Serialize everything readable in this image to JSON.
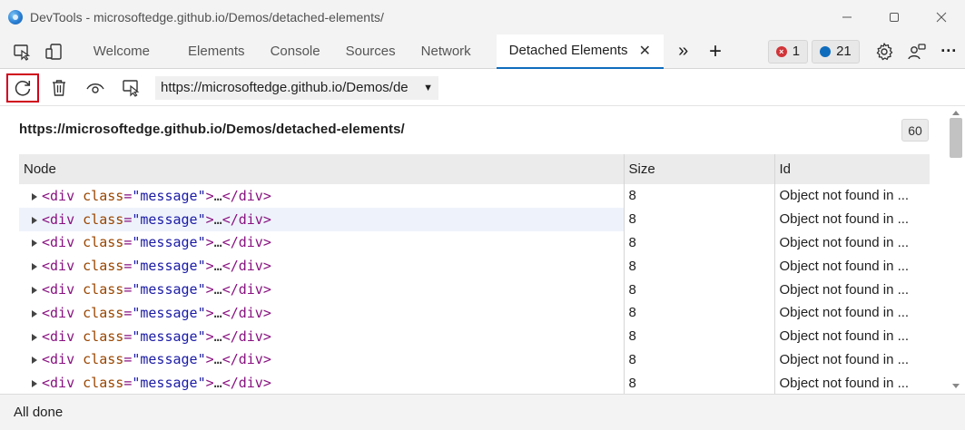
{
  "window": {
    "title": "DevTools - microsoftedge.github.io/Demos/detached-elements/",
    "icon": "edge-devtools-icon"
  },
  "tabs": [
    {
      "label": "Welcome",
      "active": false
    },
    {
      "label": "Elements",
      "active": false
    },
    {
      "label": "Console",
      "active": false
    },
    {
      "label": "Sources",
      "active": false
    },
    {
      "label": "Network",
      "active": false
    },
    {
      "label": "Detached Elements",
      "active": true
    }
  ],
  "tabstrip": {
    "more_tabs": "»",
    "add_tab": "+",
    "error_count": "1",
    "message_count": "21",
    "more_menu": "···"
  },
  "toolbar": {
    "url_select_value": "https://microsoftedge.github.io/Demos/de",
    "caret": "▼"
  },
  "content": {
    "page_url": "https://microsoftedge.github.io/Demos/detached-elements/",
    "count": "60"
  },
  "table": {
    "headers": [
      "Node",
      "Size",
      "Id"
    ],
    "rows": [
      {
        "node": {
          "tag": "div",
          "attr": "class",
          "value": "message"
        },
        "size": "8",
        "id": "Object not found in ..."
      },
      {
        "node": {
          "tag": "div",
          "attr": "class",
          "value": "message"
        },
        "size": "8",
        "id": "Object not found in ..."
      },
      {
        "node": {
          "tag": "div",
          "attr": "class",
          "value": "message"
        },
        "size": "8",
        "id": "Object not found in ..."
      },
      {
        "node": {
          "tag": "div",
          "attr": "class",
          "value": "message"
        },
        "size": "8",
        "id": "Object not found in ..."
      },
      {
        "node": {
          "tag": "div",
          "attr": "class",
          "value": "message"
        },
        "size": "8",
        "id": "Object not found in ..."
      },
      {
        "node": {
          "tag": "div",
          "attr": "class",
          "value": "message"
        },
        "size": "8",
        "id": "Object not found in ..."
      },
      {
        "node": {
          "tag": "div",
          "attr": "class",
          "value": "message"
        },
        "size": "8",
        "id": "Object not found in ..."
      },
      {
        "node": {
          "tag": "div",
          "attr": "class",
          "value": "message"
        },
        "size": "8",
        "id": "Object not found in ..."
      },
      {
        "node": {
          "tag": "div",
          "attr": "class",
          "value": "message"
        },
        "size": "8",
        "id": "Object not found in ..."
      }
    ]
  },
  "status": {
    "text": "All done"
  },
  "colors": {
    "active_tab_underline": "#0f6cbd",
    "reload_highlight": "#d0021b",
    "error_badge": "#d13438",
    "message_badge": "#0f6cbd",
    "tag_color": "#881280",
    "attr_name_color": "#994500",
    "attr_value_color": "#1a1aa6"
  }
}
